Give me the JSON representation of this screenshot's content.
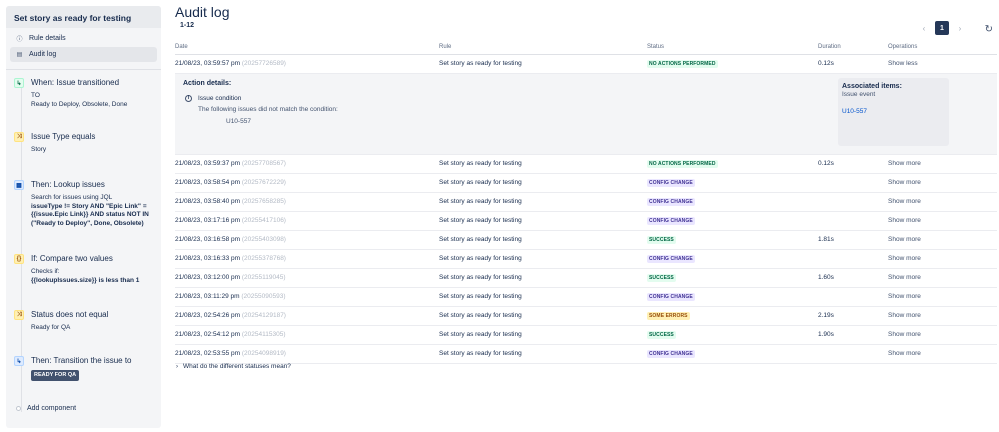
{
  "sidebar": {
    "title": "Set story as ready for testing",
    "nav": [
      {
        "label": "Rule details",
        "icon": "info-icon"
      },
      {
        "label": "Audit log",
        "icon": "document-icon"
      }
    ],
    "components": [
      {
        "title": "When: Issue transitioned",
        "icon": "transition-icon",
        "lines": [
          "TO",
          "Ready to Deploy, Obsolete, Done"
        ]
      },
      {
        "title": "Issue Type equals",
        "icon": "condition-icon",
        "lines": [
          "Story"
        ]
      },
      {
        "title": "Then: Lookup issues",
        "icon": "lookup-icon",
        "pre": "Search for issues using JQL",
        "bold": "issueType != Story AND \"Epic Link\" = {{issue.Epic Link}} AND status NOT IN (\"Ready to Deploy\", Done, Obsolete)"
      },
      {
        "title": "If: Compare two values",
        "icon": "braces-icon",
        "pre": "Checks if:",
        "bold": "{{lookupIssues.size}} is less than 1"
      },
      {
        "title": "Status does not equal",
        "icon": "condition-icon",
        "lines": [
          "Ready for QA"
        ]
      },
      {
        "title": "Then: Transition the issue to",
        "icon": "transition-icon",
        "lozenge": "READY FOR QA"
      }
    ],
    "add_label": "Add component"
  },
  "main": {
    "title": "Audit log",
    "range": "1-12",
    "page": "1",
    "columns": [
      "Date",
      "Rule",
      "Status",
      "Duration",
      "Operations"
    ],
    "expanded": {
      "title": "Action details:",
      "condition": "Issue condition",
      "description": "The following issues did not match the condition:",
      "issue": "U10-557",
      "assoc_title": "Associated items:",
      "assoc_sub": "Issue event",
      "assoc_link": "U10-557"
    },
    "rows": [
      {
        "date": "21/08/23, 03:59:57 pm",
        "id": "(20257726589)",
        "rule": "Set story as ready for testing",
        "status": "NO ACTIONS PERFORMED",
        "kind": "none",
        "duration": "0.12s",
        "op": "Show less"
      },
      {
        "date": "21/08/23, 03:59:37 pm",
        "id": "(20257708567)",
        "rule": "Set story as ready for testing",
        "status": "NO ACTIONS PERFORMED",
        "kind": "none",
        "duration": "0.12s",
        "op": "Show more"
      },
      {
        "date": "21/08/23, 03:58:54 pm",
        "id": "(20257672229)",
        "rule": "Set story as ready for testing",
        "status": "CONFIG CHANGE",
        "kind": "config",
        "duration": "",
        "op": "Show more"
      },
      {
        "date": "21/08/23, 03:58:40 pm",
        "id": "(20257658285)",
        "rule": "Set story as ready for testing",
        "status": "CONFIG CHANGE",
        "kind": "config",
        "duration": "",
        "op": "Show more"
      },
      {
        "date": "21/08/23, 03:17:16 pm",
        "id": "(20255417106)",
        "rule": "Set story as ready for testing",
        "status": "CONFIG CHANGE",
        "kind": "config",
        "duration": "",
        "op": "Show more"
      },
      {
        "date": "21/08/23, 03:16:58 pm",
        "id": "(20255403098)",
        "rule": "Set story as ready for testing",
        "status": "SUCCESS",
        "kind": "success",
        "duration": "1.81s",
        "op": "Show more"
      },
      {
        "date": "21/08/23, 03:16:33 pm",
        "id": "(20255378768)",
        "rule": "Set story as ready for testing",
        "status": "CONFIG CHANGE",
        "kind": "config",
        "duration": "",
        "op": "Show more"
      },
      {
        "date": "21/08/23, 03:12:00 pm",
        "id": "(20255119045)",
        "rule": "Set story as ready for testing",
        "status": "SUCCESS",
        "kind": "success",
        "duration": "1.60s",
        "op": "Show more"
      },
      {
        "date": "21/08/23, 03:11:29 pm",
        "id": "(20255090593)",
        "rule": "Set story as ready for testing",
        "status": "CONFIG CHANGE",
        "kind": "config",
        "duration": "",
        "op": "Show more"
      },
      {
        "date": "21/08/23, 02:54:26 pm",
        "id": "(20254129187)",
        "rule": "Set story as ready for testing",
        "status": "SOME ERRORS",
        "kind": "errors",
        "duration": "2.19s",
        "op": "Show more"
      },
      {
        "date": "21/08/23, 02:54:12 pm",
        "id": "(20254115305)",
        "rule": "Set story as ready for testing",
        "status": "SUCCESS",
        "kind": "success",
        "duration": "1.90s",
        "op": "Show more"
      },
      {
        "date": "21/08/23, 02:53:55 pm",
        "id": "(20254098919)",
        "rule": "Set story as ready for testing",
        "status": "CONFIG CHANGE",
        "kind": "config",
        "duration": "",
        "op": "Show more"
      }
    ],
    "faq": "What do the different statuses mean?"
  }
}
